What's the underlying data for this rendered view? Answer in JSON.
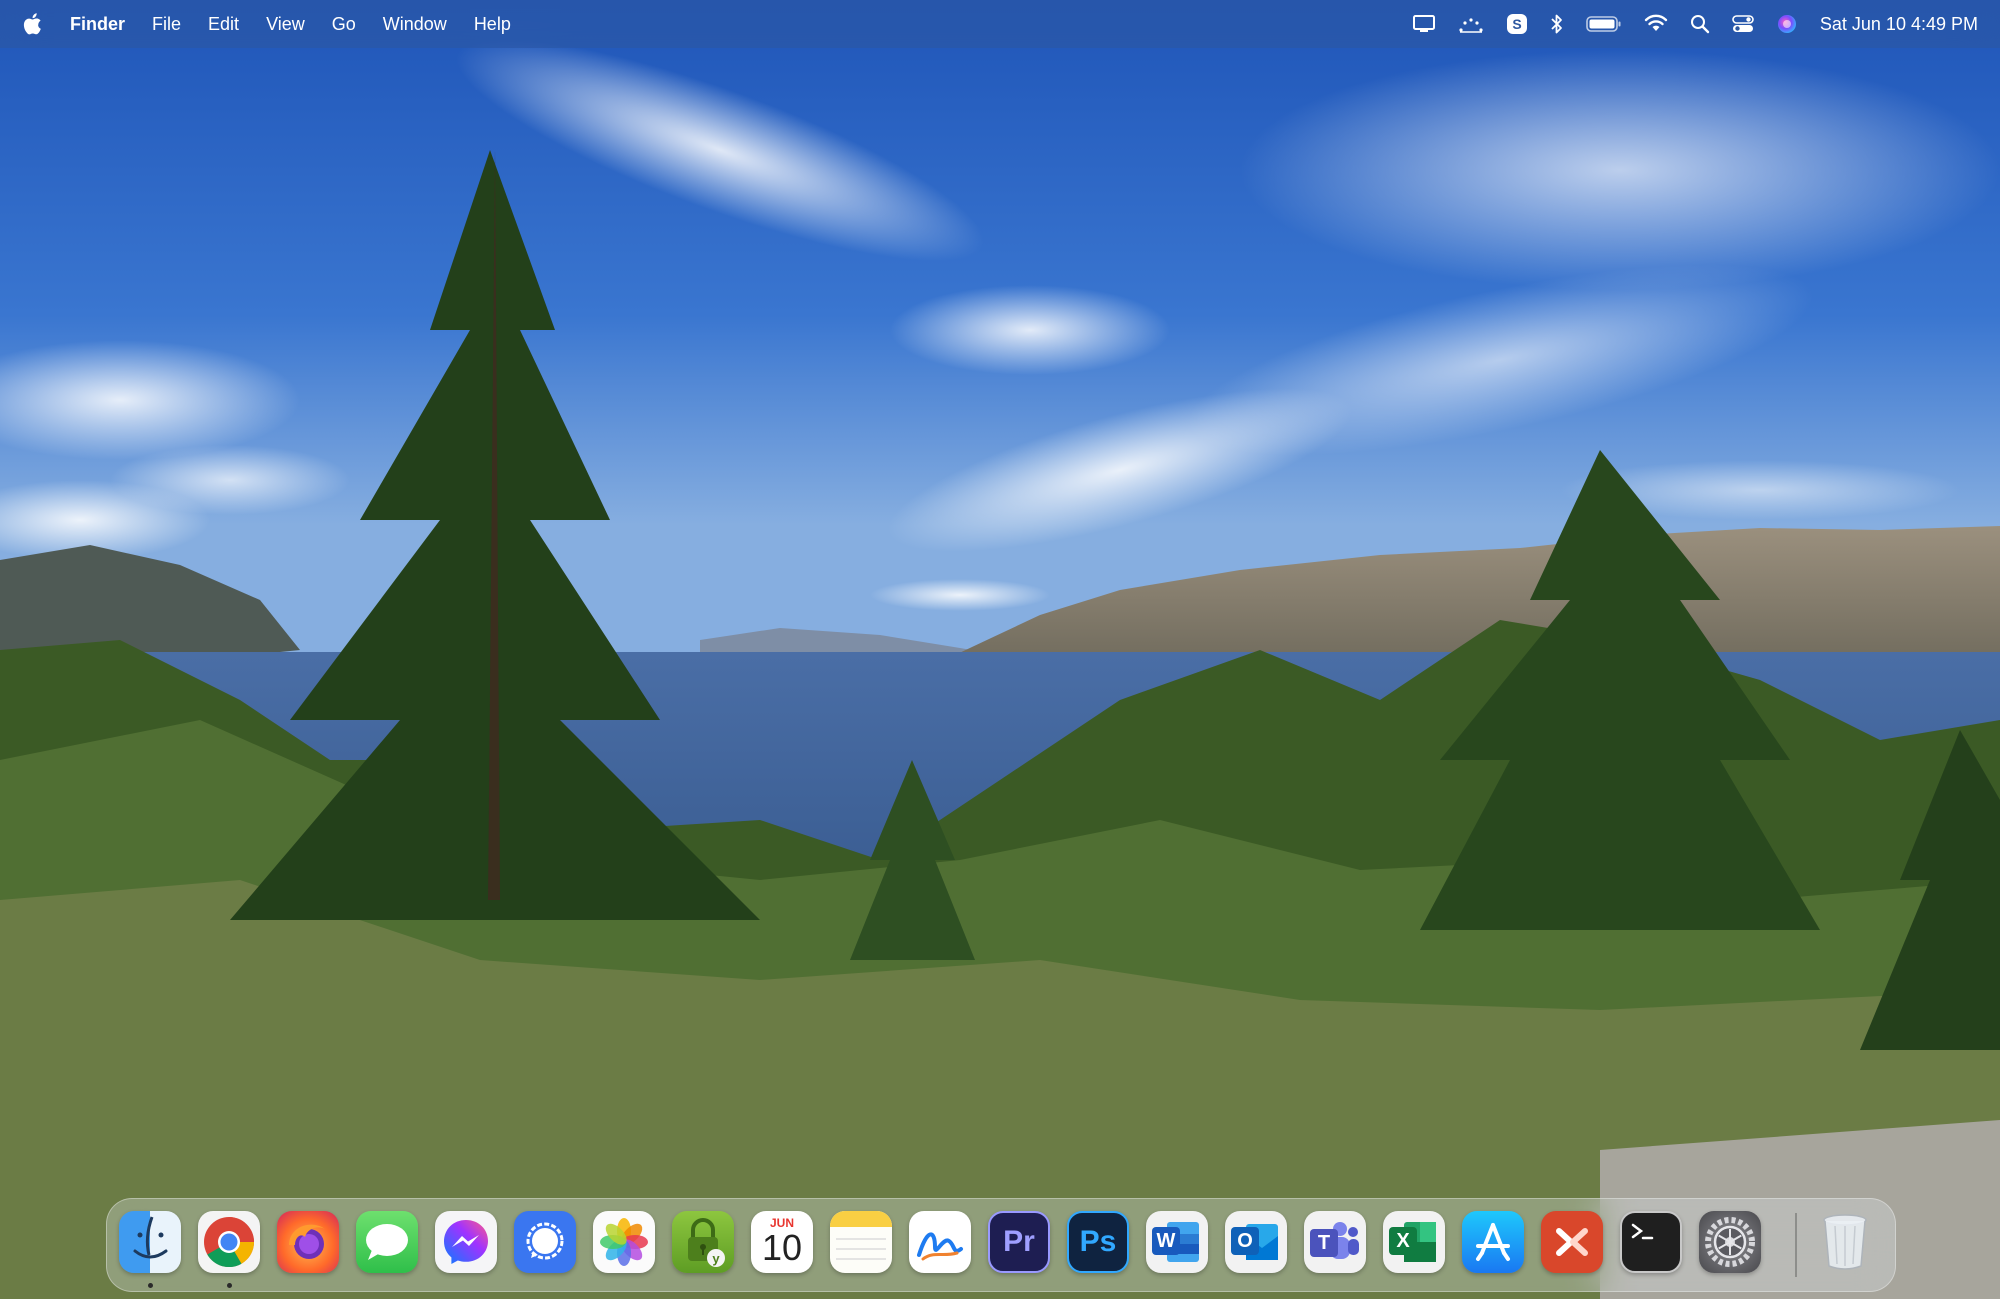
{
  "menubar": {
    "apple_icon": "apple-logo-icon",
    "app_name": "Finder",
    "menus": [
      "File",
      "Edit",
      "View",
      "Go",
      "Window",
      "Help"
    ],
    "status_icons": [
      "display-icon",
      "dots-arc-icon",
      "skype-icon",
      "bluetooth-icon",
      "battery-icon",
      "wifi-icon",
      "spotlight-search-icon",
      "control-center-icon",
      "siri-icon"
    ],
    "clock": "Sat Jun 10  4:49 PM"
  },
  "dock": {
    "apps": [
      {
        "name": "Finder",
        "icon": "finder-icon",
        "running": true
      },
      {
        "name": "Google Chrome",
        "icon": "chrome-icon",
        "running": true
      },
      {
        "name": "Firefox",
        "icon": "firefox-icon",
        "running": false
      },
      {
        "name": "Messages",
        "icon": "messages-icon",
        "running": false
      },
      {
        "name": "Messenger",
        "icon": "messenger-icon",
        "running": false
      },
      {
        "name": "Signal",
        "icon": "signal-icon",
        "running": false
      },
      {
        "name": "Photos",
        "icon": "photos-icon",
        "running": false
      },
      {
        "name": "Keychain",
        "icon": "keychain-lock-icon",
        "running": false
      },
      {
        "name": "Calendar",
        "icon": "calendar-icon",
        "running": false,
        "month": "JUN",
        "day": "10"
      },
      {
        "name": "Notes",
        "icon": "notes-icon",
        "running": false
      },
      {
        "name": "Freeform",
        "icon": "freeform-icon",
        "running": false
      },
      {
        "name": "Adobe Premiere Pro",
        "icon": "premiere-icon",
        "running": false,
        "label": "Pr"
      },
      {
        "name": "Adobe Photoshop",
        "icon": "photoshop-icon",
        "running": false,
        "label": "Ps"
      },
      {
        "name": "Microsoft Word",
        "icon": "word-icon",
        "running": false,
        "label": "W"
      },
      {
        "name": "Microsoft Outlook",
        "icon": "outlook-icon",
        "running": false,
        "label": "O"
      },
      {
        "name": "Microsoft Teams",
        "icon": "teams-icon",
        "running": false,
        "label": "T"
      },
      {
        "name": "Microsoft Excel",
        "icon": "excel-icon",
        "running": false,
        "label": "X"
      },
      {
        "name": "App Store",
        "icon": "app-store-icon",
        "running": false
      },
      {
        "name": "Microsoft Remote Desktop",
        "icon": "remote-desktop-icon",
        "running": false
      },
      {
        "name": "Terminal",
        "icon": "terminal-icon",
        "running": false
      },
      {
        "name": "System Settings",
        "icon": "system-settings-gear-icon",
        "running": false
      }
    ],
    "trash": {
      "name": "Trash",
      "icon": "trash-icon"
    }
  },
  "colors": {
    "sky": "#2f64c4",
    "lake": "#3d5f93",
    "forest": "#2c4a1f",
    "premiere": "#1e1e52",
    "photoshop": "#0f2340",
    "word": "#2b5cb8",
    "excel": "#1d7044",
    "teams": "#5a5fc6"
  }
}
